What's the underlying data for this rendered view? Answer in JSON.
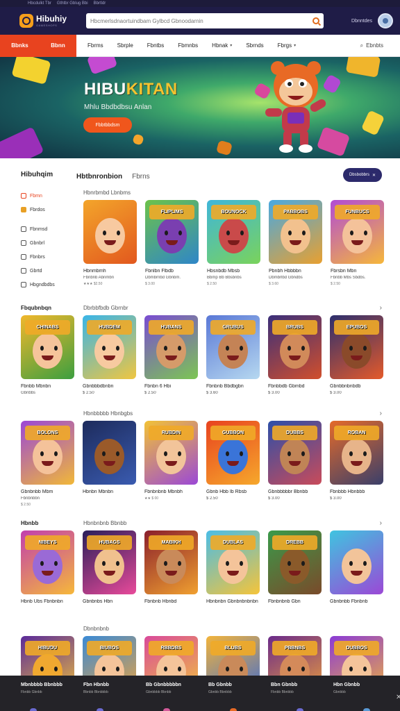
{
  "topbar": {
    "items": [
      "Hbcdulkt Tbr",
      "Gthtbr Gblug Bbi",
      "Bbrtldr"
    ]
  },
  "header": {
    "logo_name": "Hibuhiy",
    "logo_sub": "GAMESHOPS",
    "search_placeholder": "Hbcmerlsdnaortuindbam Gylbcd Gbnoodarnin",
    "account_link": "Dbnntdes"
  },
  "nav": {
    "active_left": "Bbnks",
    "active_right": "Bbnn",
    "items": [
      {
        "label": "Fbrms",
        "caret": false
      },
      {
        "label": "Sbrple",
        "caret": false
      },
      {
        "label": "Fbntbs",
        "caret": false
      },
      {
        "label": "Fbmnbs",
        "caret": false
      },
      {
        "label": "Hbnak",
        "caret": true
      },
      {
        "label": "Sbrnds",
        "caret": false
      },
      {
        "label": "Fbrgs",
        "caret": true
      }
    ],
    "right_label": "Ebnbts"
  },
  "hero": {
    "title_a": "HIBU",
    "title_b": "KITAN",
    "subtitle": "Mhlu Bbdbdbsu Anlan",
    "button": "Fbbtbbdsm"
  },
  "sidebar": {
    "title": "Hibuhqim",
    "items": [
      {
        "label": "Fbmn",
        "active": true
      },
      {
        "label": "Fbrdos",
        "active": false
      },
      {
        "label": "Fbnmsd",
        "active": false
      },
      {
        "label": "Gbnbrl",
        "active": false
      },
      {
        "label": "Fbnbrs",
        "active": false
      },
      {
        "label": "Gbrtd",
        "active": false
      },
      {
        "label": "Hbgndbdbs",
        "active": false
      }
    ]
  },
  "tabs": {
    "main": "Hbtbnronbion",
    "second": "Fbrns",
    "discover": "Dbsbobbrs"
  },
  "rows": [
    {
      "left": "",
      "mid": "Hbnrbmbd Lbnbms",
      "cards": [
        {
          "title": "Hbnmbrnh",
          "sub": "Fbnbnb Abnmbn",
          "meta": "★★★  $2.50",
          "banner": "",
          "bg": "#f3a52b",
          "bg2": "#e2581e",
          "face": "#f7c9a0"
        },
        {
          "title": "Fbnlbn Flbdb",
          "sub": "Dbmbrnbd Gbnbm.",
          "meta": "$ 3.00",
          "banner": "FLIPLIMS",
          "bg": "#6cc24a",
          "bg2": "#2f86c8",
          "face": "#7a3fb0"
        },
        {
          "title": "Hbsnbdb Mbsb",
          "sub": "Bbmp Bb Bbsbnbs",
          "meta": "$ 2.50",
          "banner": "BOUNOCK",
          "bg": "#3fb6d9",
          "bg2": "#7ad35b",
          "face": "#c94a4a"
        },
        {
          "title": "Pbnbh Hbbbbn",
          "sub": "Dbmbrlbd Gbndbs",
          "meta": "$ 3.60",
          "banner": "PABBOBS",
          "bg": "#49a9e0",
          "bg2": "#e8a030",
          "face": "#f2c18e"
        },
        {
          "title": "Fbrsbn Mbn",
          "sub": "Fbnbb Mbs Sbdbs.",
          "meta": "$ 2.50",
          "banner": "FUNBUCS",
          "bg": "#b14bd6",
          "bg2": "#f6b73a",
          "face": "#f4c29a"
        }
      ]
    },
    {
      "left": "Fbqubnbqn",
      "mid": "Dbrbbfbdb Gbrnbr",
      "cards": [
        {
          "title": "Fbnbb Mbnbn",
          "sub": "Gbnbbs",
          "meta": "",
          "banner": "CHINABS",
          "bg": "#f1b72c",
          "bg2": "#3c9f3f",
          "face": "#f5c49b"
        },
        {
          "title": "Gbnbbbdbnbn",
          "sub": "$ 2.50",
          "meta": "",
          "banner": "HUBDEM",
          "bg": "#39b5e8",
          "bg2": "#f0c640",
          "face": "#f7caa0"
        },
        {
          "title": "Fbnbn 6 Hbi",
          "sub": "$ 2.50",
          "meta": "",
          "banner": "HUBANS",
          "bg": "#7a4cd2",
          "bg2": "#7cc653",
          "face": "#d59b6a"
        },
        {
          "title": "Fbnbnb Bbdbgbn",
          "sub": "$ 3.60",
          "meta": "",
          "banner": "GRUBUS",
          "bg": "#5a78d6",
          "bg2": "#b6d8f0",
          "face": "#c48356"
        },
        {
          "title": "Fbnbbdb Gbmbd",
          "sub": "$ 3.00",
          "meta": "",
          "banner": "BRUBS",
          "bg": "#3a2f7a",
          "bg2": "#d14f2c",
          "face": "#d18a5a"
        },
        {
          "title": "Gbnbbnbnbdb",
          "sub": "$ 3.00",
          "meta": "",
          "banner": "EPUBOS",
          "bg": "#2c2f6e",
          "bg2": "#e45a2a",
          "face": "#8a4a2a"
        }
      ]
    },
    {
      "left": "",
      "mid": "Hbnbbbbb Hbnbgbs",
      "cards": [
        {
          "title": "Gbnbnbb Mbm",
          "sub": "Fbnbnbbn",
          "meta": "$ 2.50",
          "banner": "BOLONS",
          "bg": "#9b48d6",
          "bg2": "#f1b838",
          "face": "#f4c29a"
        },
        {
          "title": "Hbnbn Mbnbn",
          "sub": "",
          "meta": "",
          "banner": "",
          "bg": "#1d2b5c",
          "bg2": "#3a5bb0",
          "face": "#9a5a2a"
        },
        {
          "title": "Fbnbnbnb Mbnbh",
          "sub": "",
          "meta": "★★  $ 00",
          "banner": "RUBDIN",
          "bg": "#f2c236",
          "bg2": "#9b48d6",
          "face": "#f2c49a"
        },
        {
          "title": "Gbnb Hbb Ib Rbsb",
          "sub": "$ 2.50",
          "meta": "",
          "banner": "GUBBON",
          "bg": "#e8431f",
          "bg2": "#f6a82c",
          "face": "#3a74d8"
        },
        {
          "title": "Gbnbbbbbr Bbnbb",
          "sub": "$ 3.00",
          "meta": "",
          "banner": "DUBBS",
          "bg": "#2d4fa8",
          "bg2": "#c94b5a",
          "face": "#c08456"
        },
        {
          "title": "Fbnbbb Hbnbbb",
          "sub": "$ 3.00",
          "meta": "",
          "banner": "ROBAN",
          "bg": "#e46a2a",
          "bg2": "#3a3f6a",
          "face": "#e7b48a"
        }
      ]
    },
    {
      "left": "Hbnbb",
      "mid": "Hbnbnbnb Bbnbb",
      "cards": [
        {
          "title": "Hbnb Ubs Fbnbnbn",
          "sub": "",
          "meta": "",
          "banner": "NIBEYS",
          "bg": "#c13fae",
          "bg2": "#f6b83a",
          "face": "#9a6ad6"
        },
        {
          "title": "Gbnbnbs Hbn",
          "sub": "",
          "meta": "",
          "banner": "HUBAGS",
          "bg": "#2a1f5a",
          "bg2": "#e84a9a",
          "face": "#f0c18e"
        },
        {
          "title": "Fbnbnb Hbnbd",
          "sub": "",
          "meta": "",
          "banner": "MABIKH",
          "bg": "#8a1f2c",
          "bg2": "#f0a030",
          "face": "#c98a5a"
        },
        {
          "title": "Hbnbnbn Gbnbnbnbnbn",
          "sub": "",
          "meta": "",
          "banner": "DUBLAS",
          "bg": "#4abde6",
          "bg2": "#f5c43a",
          "face": "#f4c49a"
        },
        {
          "title": "Fbnbnbnb Gbn",
          "sub": "",
          "meta": "",
          "banner": "DREBB",
          "bg": "#3a9a4a",
          "bg2": "#7a4a2a",
          "face": "#8a5a2a"
        },
        {
          "title": "Gbnbnbb Fbnbnb",
          "sub": "",
          "meta": "",
          "banner": "",
          "bg": "#3fc4e0",
          "bg2": "#9b48d6",
          "face": "#f2c49a"
        }
      ]
    },
    {
      "left": "",
      "mid": "Dbnbnbnb",
      "cards": [
        {
          "title": "",
          "sub": "",
          "meta": "",
          "banner": "HIBUDU",
          "bg": "#5a2a9a",
          "bg2": "#f2c23a",
          "face": "#f0a830"
        },
        {
          "title": "",
          "sub": "",
          "meta": "",
          "banner": "BIUBOS",
          "bg": "#3a8ad6",
          "bg2": "#f1a43a",
          "face": "#f4c49a"
        },
        {
          "title": "",
          "sub": "",
          "meta": "",
          "banner": "RBBDBS",
          "bg": "#d94a9a",
          "bg2": "#f2c83a",
          "face": "#f4c49a"
        },
        {
          "title": "",
          "sub": "",
          "meta": "",
          "banner": "BLUBS",
          "bg": "#f3b43a",
          "bg2": "#3a6ad6",
          "face": "#c98a5a"
        },
        {
          "title": "",
          "sub": "",
          "meta": "",
          "banner": "PBBNBS",
          "bg": "#6a2a8a",
          "bg2": "#f0a23a",
          "face": "#d48a5a"
        },
        {
          "title": "",
          "sub": "",
          "meta": "",
          "banner": "DUBBOS",
          "bg": "#8a3ad6",
          "bg2": "#f2b43a",
          "face": "#f4c49a"
        }
      ]
    }
  ],
  "footer": [
    {
      "title": "Mbnbbbb Bbnbbb",
      "sub": "Fbnbb Gbnbb"
    },
    {
      "title": "Fbn Hbnbb",
      "sub": "Bbnbb Bbnbbbb"
    },
    {
      "title": "Bb Gbnbbbbbn",
      "sub": "Gbnbbbb Bbnbb"
    },
    {
      "title": "Bb Gbnbb",
      "sub": "Gbnbb Bbnbbb"
    },
    {
      "title": "Bbn Gbnbb",
      "sub": "Fbnbb Bbnbbb"
    },
    {
      "title": "Hbn Gbnbb",
      "sub": "Gbnbbb"
    }
  ],
  "colors": {
    "brand_dark": "#1f1c47",
    "accent": "#e8431f",
    "footer": "#242328"
  }
}
